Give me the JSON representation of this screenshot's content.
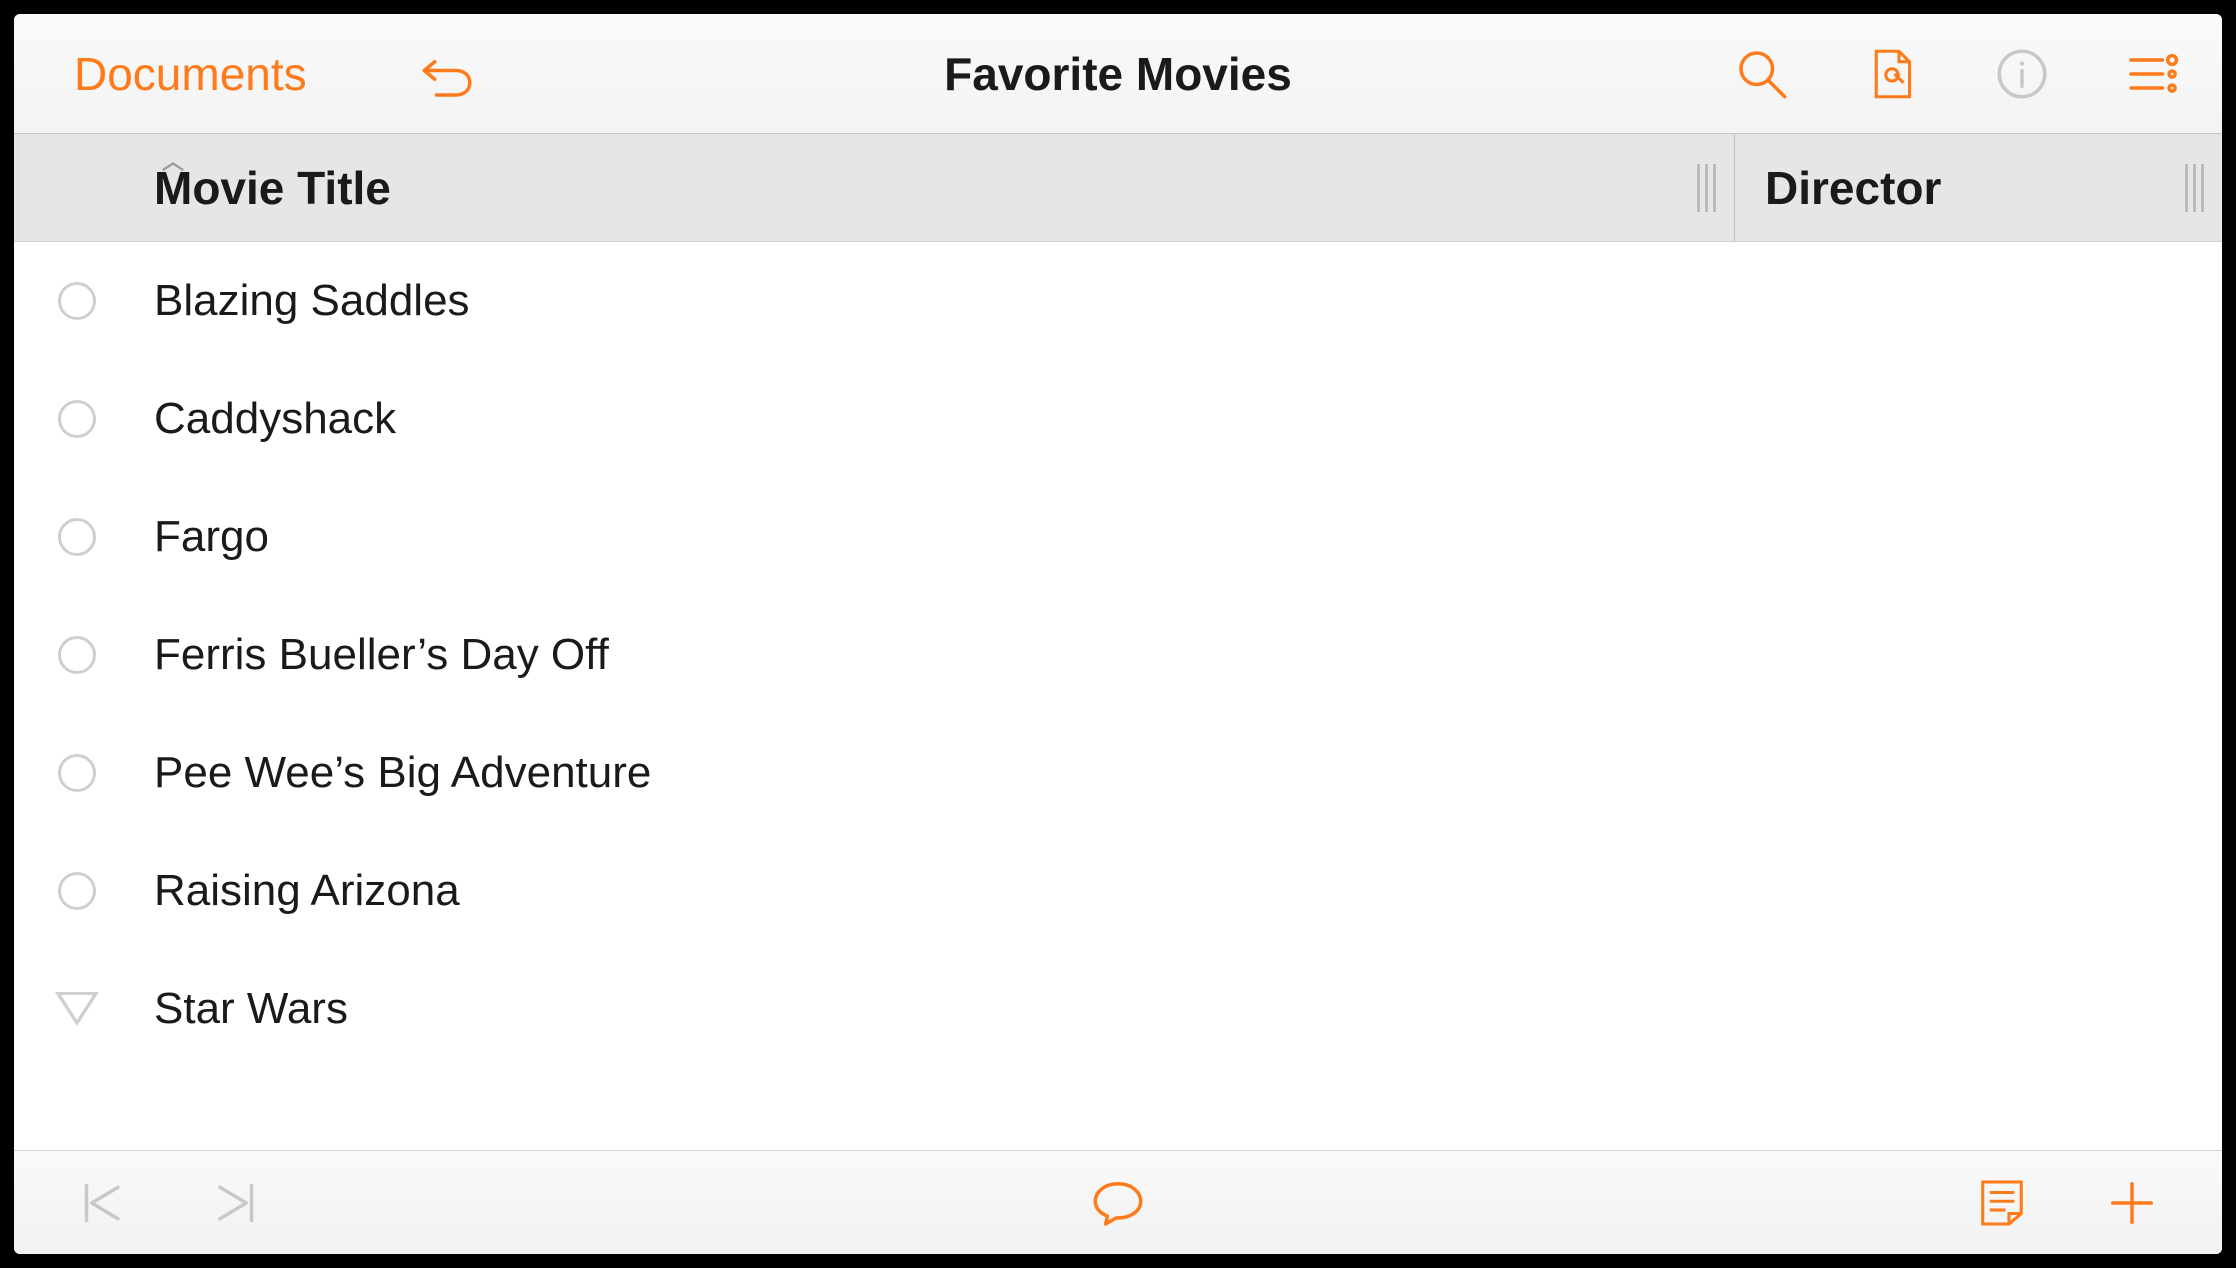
{
  "header": {
    "documents_label": "Documents",
    "title": "Favorite Movies"
  },
  "columns": {
    "title_label": "Movie Title",
    "director_label": "Director",
    "sort_direction": "ascending"
  },
  "rows": [
    {
      "title": "Blazing Saddles",
      "expandable": false
    },
    {
      "title": "Caddyshack",
      "expandable": false
    },
    {
      "title": "Fargo",
      "expandable": false
    },
    {
      "title": "Ferris Bueller’s Day Off",
      "expandable": false
    },
    {
      "title": "Pee Wee’s Big Adventure",
      "expandable": false
    },
    {
      "title": "Raising Arizona",
      "expandable": false
    },
    {
      "title": "Star Wars",
      "expandable": true
    }
  ],
  "icons": {
    "undo": "undo-icon",
    "search": "search-icon",
    "wrench_doc": "wrench-document-icon",
    "info": "info-icon",
    "list_options": "list-options-icon",
    "nav_first": "nav-first-icon",
    "nav_last": "nav-last-icon",
    "comment": "comment-icon",
    "note": "note-icon",
    "add": "add-icon"
  },
  "colors": {
    "accent": "#ff7a1a",
    "muted": "#c8c8c8"
  }
}
